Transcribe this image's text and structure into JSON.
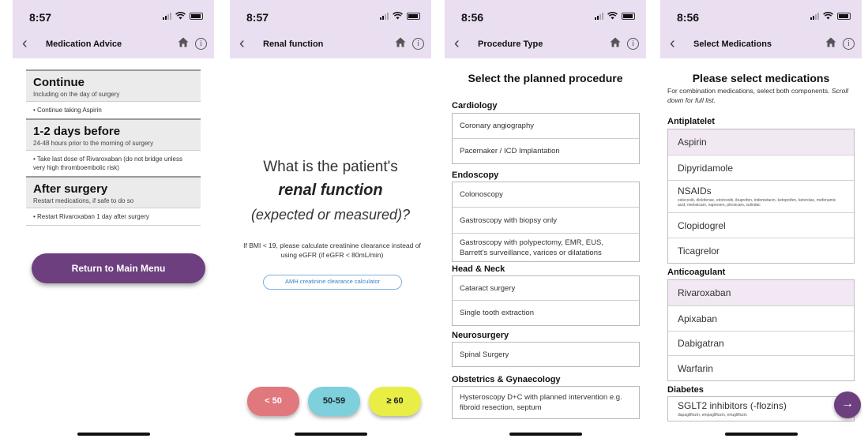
{
  "colors": {
    "header_bg": "#eadff1",
    "primary_purple": "#6d3f7e",
    "low_red": "#e0787e",
    "mid_teal": "#7ed0dc",
    "high_yellow": "#e8ee45",
    "link_blue": "#3b82c4"
  },
  "screens": [
    {
      "time": "8:57",
      "title": "Medication Advice",
      "sections": [
        {
          "heading": "Continue",
          "sub": "Including on the day of surgery",
          "items": [
            "• Continue taking Aspirin"
          ]
        },
        {
          "heading": "1-2 days before",
          "sub": "24-48 hours prior to the morning of surgery",
          "items": [
            "• Take last dose of Rivaroxaban (do not bridge unless very high thromboembolic risk)"
          ]
        },
        {
          "heading": "After surgery",
          "sub": "Restart medications, if safe to do so",
          "items": [
            "• Restart Rivaroxaban 1 day after surgery"
          ]
        }
      ],
      "main_button": "Return to Main Menu"
    },
    {
      "time": "8:57",
      "title": "Renal function",
      "question_line1": "What is the patient's",
      "question_line2": "renal function",
      "question_line3": "(expected or measured)?",
      "note": "If BMI < 19, please calculate creatinine clearance instead of using eGFR (if eGFR < 80mL/min)",
      "calculator_link": "AMH creatinine clearance calculator",
      "buttons": [
        "< 50",
        "50-59",
        "≥ 60"
      ]
    },
    {
      "time": "8:56",
      "title": "Procedure Type",
      "heading": "Select the planned procedure",
      "categories": [
        {
          "name": "Cardiology",
          "items": [
            "Coronary angiography",
            "Pacemaker / ICD Implantation"
          ]
        },
        {
          "name": "Endoscopy",
          "items": [
            "Colonoscopy",
            "Gastroscopy with biopsy only",
            "Gastroscopy with polypectomy, EMR, EUS, Barrett's surveillance, varices or dilatations"
          ]
        },
        {
          "name": "Head & Neck",
          "items": [
            "Cataract surgery",
            "Single tooth extraction"
          ]
        },
        {
          "name": "Neurosurgery",
          "items": [
            "Spinal Surgery"
          ]
        },
        {
          "name": "Obstetrics & Gynaecology",
          "items": [
            "Hysteroscopy D+C with planned intervention e.g. fibroid resection, septum"
          ]
        }
      ]
    },
    {
      "time": "8:56",
      "title": "Select Medications",
      "heading": "Please select medications",
      "subtitle_prefix": "For combination medications, select both components. ",
      "subtitle_italic": "Scroll down for full list.",
      "categories": [
        {
          "name": "Antiplatelet",
          "items": [
            {
              "label": "Aspirin",
              "selected": true
            },
            {
              "label": "Dipyridamole"
            },
            {
              "label": "NSAIDs",
              "sub": "celecoxib, diclofenac, etoricoxib, ibuprofen, indometacin, ketoprofen, ketorolac, mefenamic acid, meloxicam, naproxen, piroxicam, sulindac"
            },
            {
              "label": "Clopidogrel"
            },
            {
              "label": "Ticagrelor"
            }
          ]
        },
        {
          "name": "Anticoagulant",
          "items": [
            {
              "label": "Rivaroxaban",
              "selected": true
            },
            {
              "label": "Apixaban"
            },
            {
              "label": "Dabigatran"
            },
            {
              "label": "Warfarin"
            }
          ]
        },
        {
          "name": "Diabetes",
          "items": [
            {
              "label": "SGLT2 inhibitors (-flozins)",
              "sub": "dapagliflozin, empagliflozin, ertugliflozin"
            }
          ]
        }
      ],
      "fab_icon": "arrow-right-icon"
    }
  ]
}
